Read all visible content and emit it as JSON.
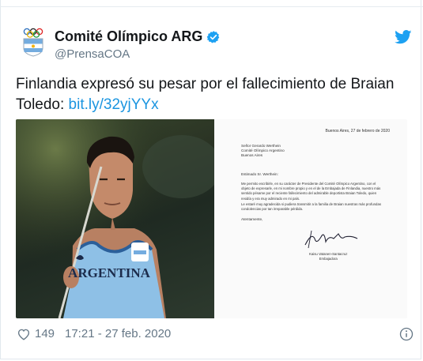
{
  "author": {
    "name": "Comité Olímpico ARG",
    "handle": "@PrensaCOA"
  },
  "tweet": {
    "text": "Finlandia expresó su pesar por el fallecimiento de Braian Toledo: ",
    "link": "bit.ly/32yjYYx"
  },
  "photo": {
    "jersey_text": "ARGENTINA"
  },
  "letter": {
    "date": "Buenos Aires, 27 de febrero de 2020",
    "recipient": "Señor Gerardo Werthein\nComité Olímpico Argentino\nBuenos Aires",
    "greeting": "Estimado Sr. Werthein:",
    "paragraph1": "Me permito escribirle, en su carácter de Presidente del Comité Olímpico Argentino, con el objeto de expresarle, en mi nombre propio y en el de la Embajada de Finlandia, nuestro más sentido pésame por el reciente fallecimiento del admirable deportista Braian Toledo, quien residía y era muy admirado en mi país.",
    "paragraph2": "Le estaré muy agradecida si pudiera transmitir a la familia de Braian nuestras más profundas condolencias por tan irreparable pérdida.",
    "closing": "Atentamente,",
    "signer": "Kaisu Vatanen-Santacruz\nEmbajadora"
  },
  "footer": {
    "likes": "149",
    "timestamp": "17:21 - 27 feb. 2020"
  },
  "colors": {
    "link": "#1b95e0",
    "secondary_text": "#657786",
    "verified": "#1da1f2"
  }
}
